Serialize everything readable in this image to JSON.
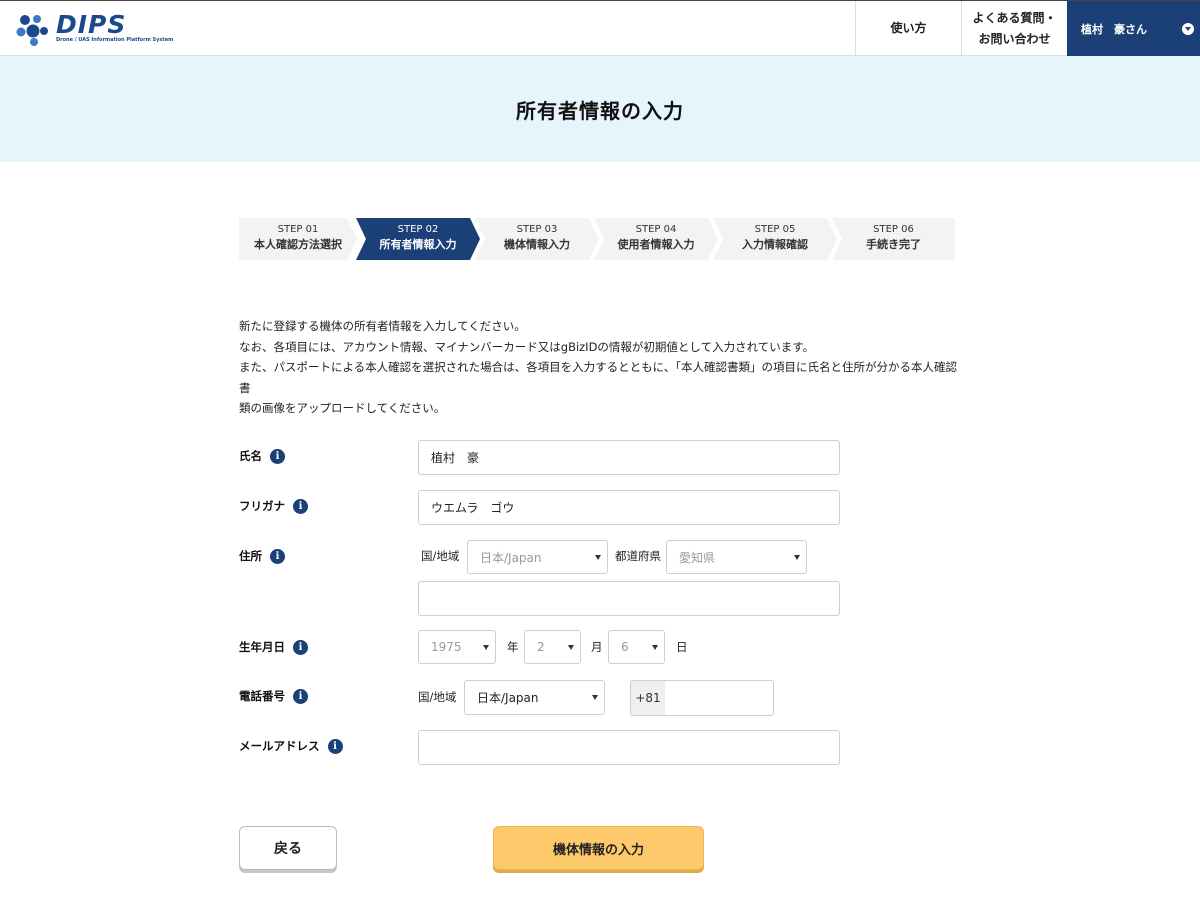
{
  "header": {
    "logo_text": "DIPS",
    "logo_subtitle": "Drone / UAS Information Platform System",
    "nav_howto": "使い方",
    "nav_faq_line1": "よくある質問・",
    "nav_faq_line2": "お問い合わせ",
    "user_name": "植村　豪さん",
    "brand_color": "#1b3f77"
  },
  "page_title": "所有者情報の入力",
  "steps": [
    {
      "num": "STEP 01",
      "label": "本人確認方法選択",
      "active": false
    },
    {
      "num": "STEP 02",
      "label": "所有者情報入力",
      "active": true
    },
    {
      "num": "STEP 03",
      "label": "機体情報入力",
      "active": false
    },
    {
      "num": "STEP 04",
      "label": "使用者情報入力",
      "active": false
    },
    {
      "num": "STEP 05",
      "label": "入力情報確認",
      "active": false
    },
    {
      "num": "STEP 06",
      "label": "手続き完了",
      "active": false
    }
  ],
  "intro": {
    "line1": "新たに登録する機体の所有者情報を入力してください。",
    "line2": "なお、各項目には、アカウント情報、マイナンバーカード又はgBizIDの情報が初期値として入力されています。",
    "line3": "また、パスポートによる本人確認を選択された場合は、各項目を入力するとともに、「本人確認書類」の項目に氏名と住所が分かる本人確認書",
    "line4": "類の画像をアップロードしてください。"
  },
  "form": {
    "name": {
      "label": "氏名",
      "value": "植村　豪"
    },
    "furigana": {
      "label": "フリガナ",
      "value": "ウエムラ　ゴウ"
    },
    "address": {
      "label": "住所",
      "country_label": "国/地域",
      "country_value": "日本/Japan",
      "prefecture_label": "都道府県",
      "prefecture_value": "愛知県",
      "detail_value": ""
    },
    "birthday": {
      "label": "生年月日",
      "year": "1975",
      "year_unit": "年",
      "month": "2",
      "month_unit": "月",
      "day": "6",
      "day_unit": "日"
    },
    "phone": {
      "label": "電話番号",
      "country_label": "国/地域",
      "country_value": "日本/Japan",
      "prefix": "+81",
      "value": ""
    },
    "email": {
      "label": "メールアドレス",
      "value": ""
    }
  },
  "buttons": {
    "back": "戻る",
    "next": "機体情報の入力",
    "next_color": "#fdc96b"
  },
  "icons": {
    "info": "i"
  }
}
